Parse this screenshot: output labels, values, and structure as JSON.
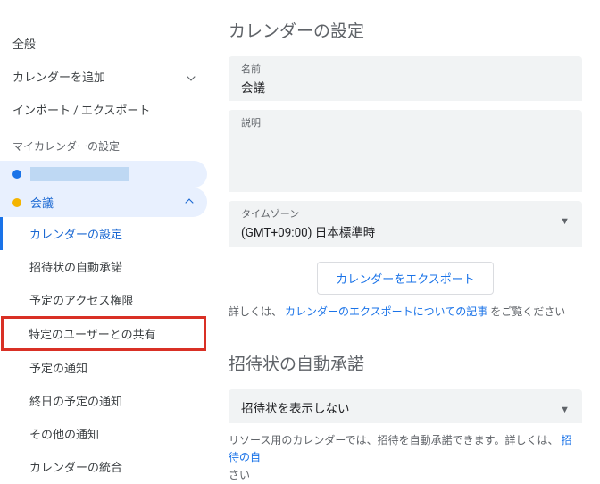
{
  "sidebar": {
    "general": "全般",
    "add_calendar": "カレンダーを追加",
    "import_export": "インポート / エクスポート",
    "my_cal_section": "マイカレンダーの設定",
    "meeting_label": "会議",
    "sub": {
      "settings": "カレンダーの設定",
      "auto_accept": "招待状の自動承諾",
      "access": "予定のアクセス権限",
      "share_users": "特定のユーザーとの共有",
      "event_notify": "予定の通知",
      "allday_notify": "終日の予定の通知",
      "other_notify": "その他の通知",
      "integration": "カレンダーの統合"
    }
  },
  "main": {
    "section_settings": "カレンダーの設定",
    "name_label": "名前",
    "name_value": "会議",
    "description_label": "説明",
    "timezone_label": "タイムゾーン",
    "timezone_value": "(GMT+09:00) 日本標準時",
    "export_btn": "カレンダーをエクスポート",
    "export_hint_pre": "詳しくは、",
    "export_hint_link": "カレンダーのエクスポートについての記事",
    "export_hint_post": "をご覧ください",
    "section_autoaccept": "招待状の自動承諾",
    "autoaccept_value": "招待状を表示しない",
    "autoaccept_hint_pre": "リソース用のカレンダーでは、招待を自動承諾できます。詳しくは、",
    "autoaccept_hint_link": "招待の自",
    "autoaccept_hint_post": "さい"
  }
}
